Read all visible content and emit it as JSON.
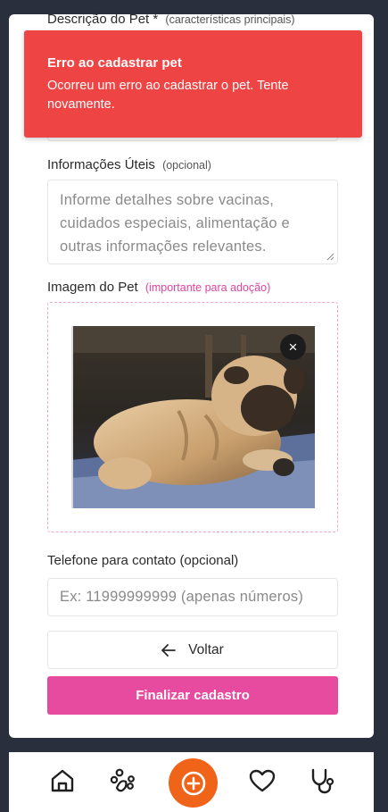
{
  "form": {
    "description": {
      "label": "Descrição do Pet *",
      "hint": "(características principais)"
    },
    "useful_info": {
      "label": "Informações Úteis",
      "hint": "(opcional)",
      "placeholder": "Informe detalhes sobre vacinas, cuidados especiais, alimentação e outras informações relevantes."
    },
    "image": {
      "label": "Imagem do Pet",
      "hint": "(importante para adoção)",
      "remove_symbol": "×"
    },
    "phone": {
      "label": "Telefone para contato (opcional)",
      "placeholder": "Ex: 11999999999 (apenas números)"
    },
    "back_label": "Voltar",
    "submit_label": "Finalizar cadastro"
  },
  "toast": {
    "title": "Erro ao cadastrar pet",
    "message": "Ocorreu um erro ao cadastrar o pet. Tente novamente."
  },
  "nav": {
    "items": [
      {
        "icon": "home-icon"
      },
      {
        "icon": "paw-icon"
      },
      {
        "icon": "add-circle-icon"
      },
      {
        "icon": "heart-icon"
      },
      {
        "icon": "stethoscope-icon"
      }
    ]
  },
  "colors": {
    "accent_pink": "#e64b9f",
    "error_red": "#ef4444",
    "fab_orange": "#f06419",
    "background": "#2a2f3e"
  }
}
